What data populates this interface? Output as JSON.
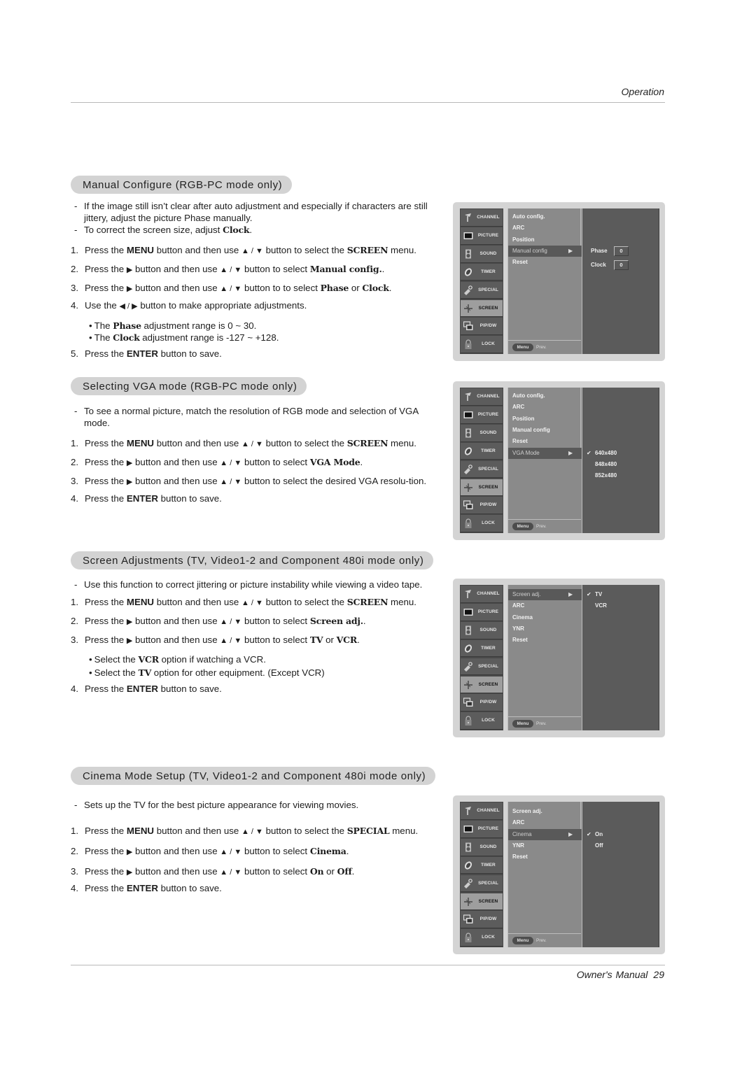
{
  "header": {
    "section": "Operation"
  },
  "footer": {
    "label": "Owner's Manual",
    "page": "29"
  },
  "colors": {
    "pill": "#d3d3d3",
    "osd_frame": "#d4d4d4",
    "osd_left": "#4a4a4a",
    "osd_active_tab": "#9e9e9e",
    "osd_mid": "#8a8a8a",
    "osd_right": "#5b5b5b"
  },
  "osd_tabs": [
    {
      "label": "CHANNEL",
      "icon": "satellite-dish-icon"
    },
    {
      "label": "PICTURE",
      "icon": "tv-screen-icon"
    },
    {
      "label": "SOUND",
      "icon": "speaker-icon"
    },
    {
      "label": "TIMER",
      "icon": "clock-icon"
    },
    {
      "label": "SPECIAL",
      "icon": "key-icon"
    },
    {
      "label": "SCREEN",
      "icon": "screen-adjust-icon"
    },
    {
      "label": "PIP/DW",
      "icon": "pip-icon"
    },
    {
      "label": "LOCK",
      "icon": "padlock-icon"
    }
  ],
  "osd_footer": {
    "menu": "Menu",
    "prev": "Prev."
  },
  "sections": [
    {
      "title": "Manual Configure (RGB-PC mode only)",
      "notes": [
        "If the image still isn't clear after auto adjustment and especially if characters are still jittery, adjust the picture Phase manually.",
        "To correct the screen size, adjust Clock."
      ],
      "steps": [
        "Press the MENU button and then use ▲ / ▼ button to select the SCREEN menu.",
        "Press the ▶ button and then use ▲ / ▼ button to select Manual config..",
        "Press the ▶ button and then use ▲ / ▼ button to to select Phase or Clock.",
        "Use the ◀ / ▶ button to make appropriate adjustments.",
        "Press the ENTER button to save."
      ],
      "sub_notes": [
        "The Phase  adjustment range is 0 ~ 30.",
        "The Clock adjustment range is -127 ~ +128."
      ],
      "osd": {
        "active_tab": "SCREEN",
        "menu_items": [
          "Auto config.",
          "ARC",
          "Position",
          "Manual config",
          "Reset"
        ],
        "selected_item": "Manual config",
        "fields": [
          {
            "label": "Phase",
            "value": "0"
          },
          {
            "label": "Clock",
            "value": "0"
          }
        ]
      }
    },
    {
      "title": "Selecting VGA mode (RGB-PC mode only)",
      "notes": [
        "To see a normal picture, match the resolution of RGB mode and selection of VGA mode."
      ],
      "steps": [
        "Press the MENU button and then use ▲ / ▼ button to select the SCREEN menu.",
        "Press the ▶ button and then use ▲ / ▼ button to select VGA Mode.",
        "Press the ▶ button and then use ▲ / ▼ button to select the desired VGA resolution.",
        "Press the ENTER button to save."
      ],
      "osd": {
        "active_tab": "SCREEN",
        "menu_items": [
          "Auto config.",
          "ARC",
          "Position",
          "Manual config",
          "Reset",
          "VGA Mode"
        ],
        "selected_item": "VGA Mode",
        "options": [
          "640x480",
          "848x480",
          "852x480"
        ],
        "checked_option": "640x480"
      }
    },
    {
      "title": "Screen Adjustments (TV, Video1-2 and Component 480i mode only)",
      "notes": [
        "Use this function to correct jittering or picture instability while viewing a video tape."
      ],
      "steps": [
        "Press the MENU button and then use ▲ / ▼ button to select the SCREEN menu.",
        "Press the ▶ button and then use ▲ / ▼ button to select Screen adj..",
        "Press the ▶ button and then use ▲ / ▼ button to select TV or VCR.",
        "Press the ENTER button to save."
      ],
      "sub_notes": [
        "Select the VCR option if watching a VCR.",
        "Select the TV option for other equipment. (Except VCR)"
      ],
      "osd": {
        "active_tab": "SCREEN",
        "menu_items": [
          "Screen adj.",
          "ARC",
          "Cinema",
          "YNR",
          "Reset"
        ],
        "selected_item": "Screen adj.",
        "options": [
          "TV",
          "VCR"
        ],
        "checked_option": "TV"
      }
    },
    {
      "title": "Cinema Mode Setup (TV, Video1-2 and Component 480i mode only)",
      "notes": [
        "Sets up the TV for the best picture appearance for viewing movies."
      ],
      "steps": [
        "Press the MENU button and then use ▲ / ▼ button to select the SPECIAL menu.",
        "Press the ▶  button and then use ▲ / ▼ button to select Cinema.",
        "Press the ▶  button and then use ▲ / ▼ button to select On or Off.",
        "Press the ENTER button to save."
      ],
      "osd": {
        "active_tab": "SCREEN",
        "menu_items": [
          "Screen adj.",
          "ARC",
          "Cinema",
          "YNR",
          "Reset"
        ],
        "selected_item": "Cinema",
        "options": [
          "On",
          "Off"
        ],
        "checked_option": "On"
      }
    }
  ]
}
